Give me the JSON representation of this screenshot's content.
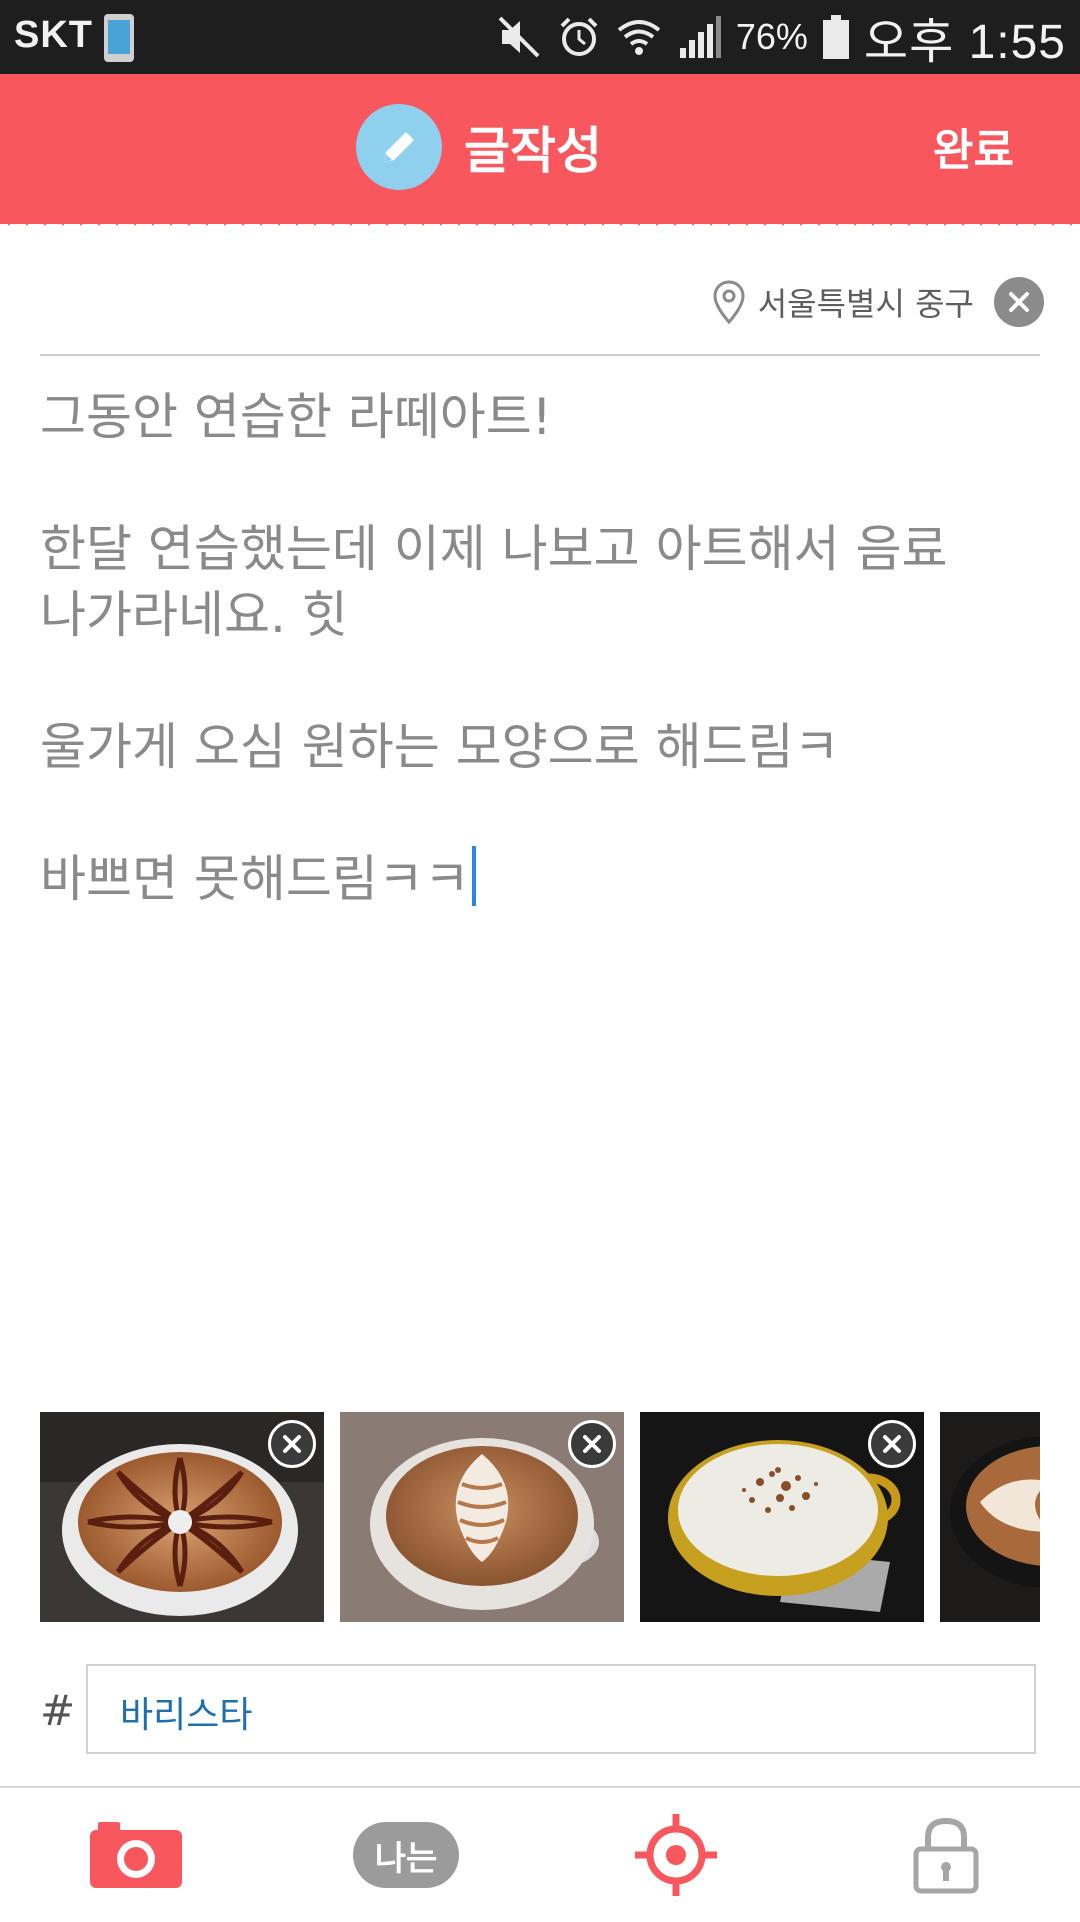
{
  "status_bar": {
    "carrier": "SKT",
    "battery_percent": "76%",
    "time": "오후 1:55",
    "icons": [
      "phone-icon",
      "mute-icon",
      "alarm-icon",
      "wifi-icon",
      "signal-icon",
      "battery-icon"
    ]
  },
  "header": {
    "title": "글작성",
    "done_label": "완료",
    "icon": "pencil-icon",
    "bg_color": "#f8575d",
    "badge_color": "#8fd0ef"
  },
  "location": {
    "text": "서울특별시 중구",
    "icon": "location-pin-icon"
  },
  "post": {
    "lines": [
      "그동안 연습한 라떼아트!",
      "",
      "한달 연습했는데 이제 나보고 아트해서 음료",
      "나가라네요. 힛",
      "",
      "울가게 오심 원하는 모양으로 해드림ㅋ",
      "",
      "바쁘면 못해드림ㅋㅋ"
    ]
  },
  "photos": [
    {
      "subject": "latte art flower pattern with chocolate",
      "removable": true
    },
    {
      "subject": "latte art rosetta heart",
      "removable": true
    },
    {
      "subject": "milk drink with cinnamon powder",
      "removable": true
    },
    {
      "subject": "latte art heart (partially visible)",
      "removable": false
    }
  ],
  "tags": {
    "prefix": "#",
    "value": "바리스타"
  },
  "bottom_bar": {
    "me_label": "나는",
    "icons": [
      "camera-icon",
      "me-icon",
      "target-icon",
      "lock-icon"
    ],
    "accent_color": "#f8575d"
  }
}
